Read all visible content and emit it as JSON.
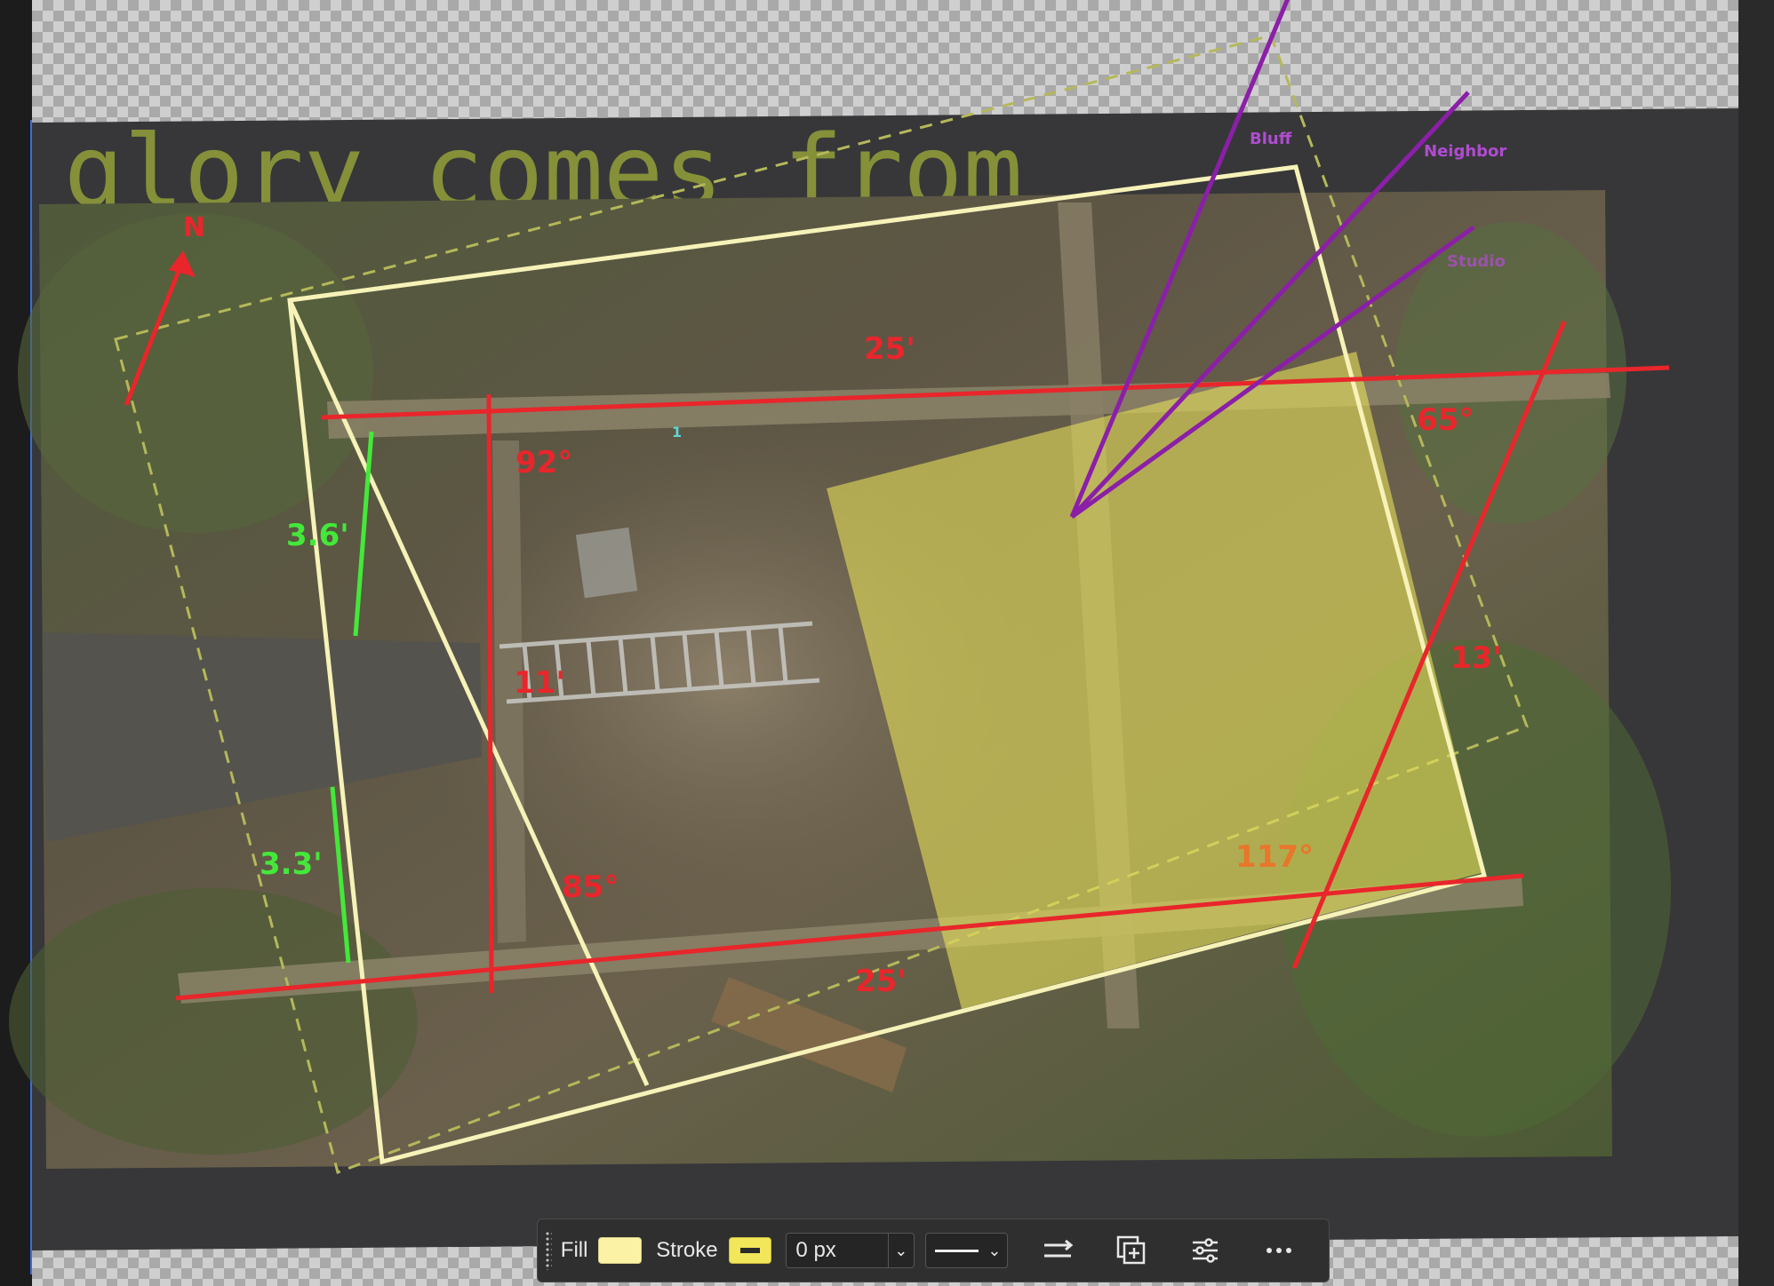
{
  "overlay_text": {
    "headline": "glory comes from",
    "north": "N",
    "directions": {
      "bluff": "Bluff",
      "neighbor": "Neighbor",
      "studio": "Studio"
    }
  },
  "measurements": {
    "top_length": "25'",
    "bottom_length": "25'",
    "left_width": "11'",
    "right_width": "13'",
    "angle_top_left": "92°",
    "angle_bottom_left": "85°",
    "angle_top_right": "65°",
    "angle_bottom_right": "117°",
    "gap_upper": "3.6'",
    "gap_lower": "3.3'"
  },
  "anchor_point": "1",
  "toolbar": {
    "fill_label": "Fill",
    "stroke_label": "Stroke",
    "stroke_width": "0 px"
  },
  "colors": {
    "measure_red": "#e8262b",
    "gap_green": "#44e83a",
    "direction_purple": "#8b1fa8",
    "outline_cream": "#f6f2b8",
    "fill_yellow": "#e6e05a",
    "dashed_olive": "#b5b85a"
  }
}
